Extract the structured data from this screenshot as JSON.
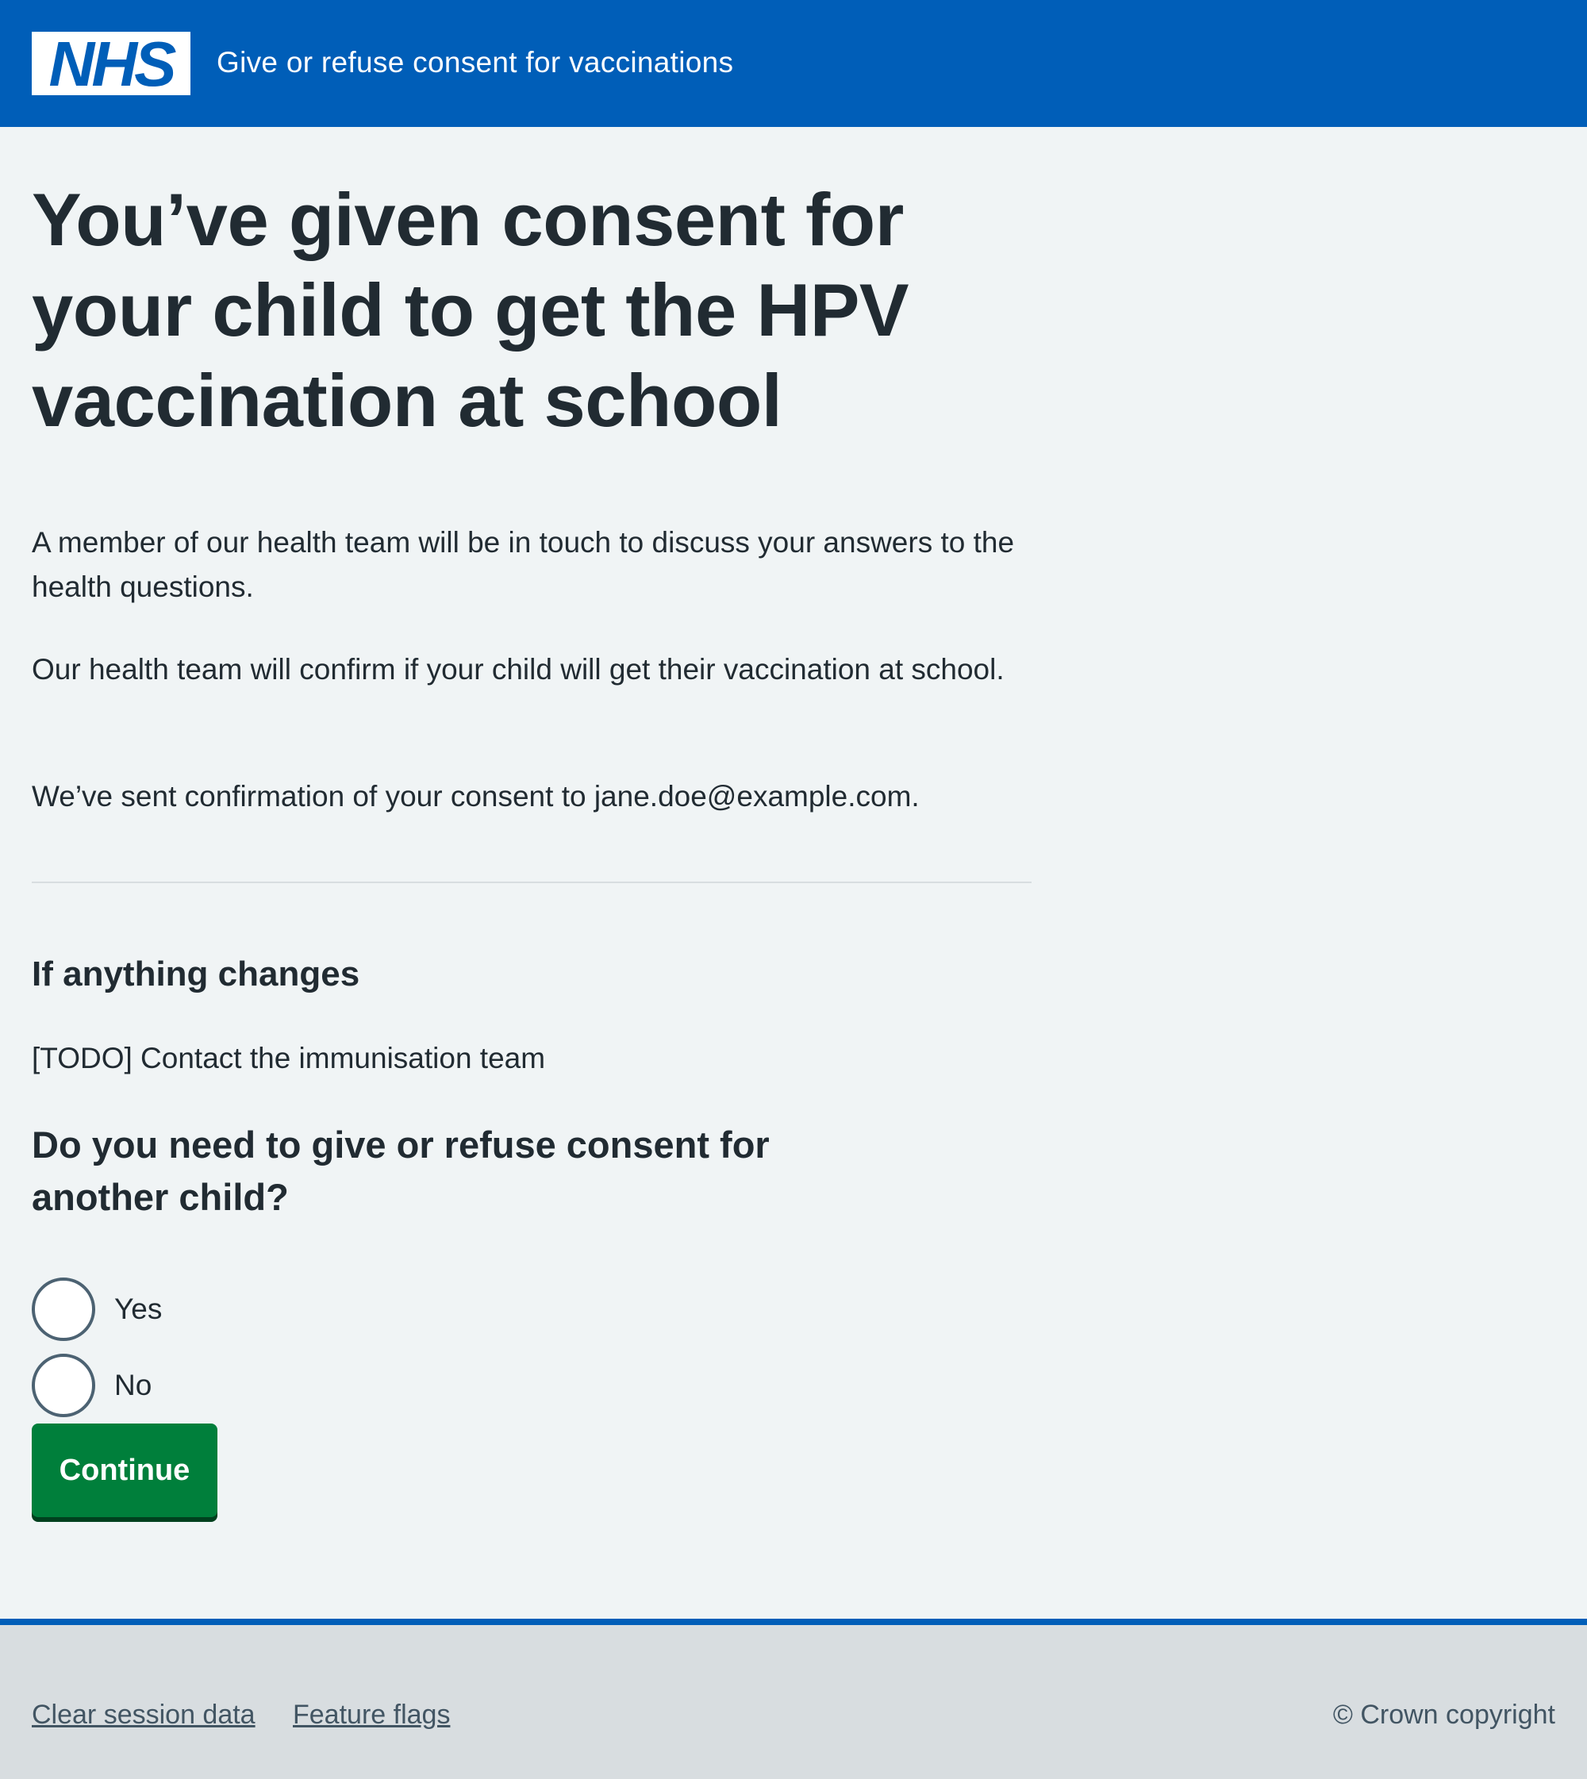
{
  "header": {
    "logo_text": "NHS",
    "service_name": "Give or refuse consent for vaccinations"
  },
  "main": {
    "title": "You’ve given consent for your child to get the HPV vaccination at school",
    "paragraphs": [
      "A member of our health team will be in touch to discuss your answers to the health questions.",
      "Our health team will confirm if your child will get their vaccination at school.",
      "We’ve sent confirmation of your consent to jane.doe@example.com."
    ],
    "changes_heading": "If anything changes",
    "changes_text": "[TODO] Contact the immunisation team",
    "question": "Do you need to give or refuse consent for another child?",
    "options": [
      "Yes",
      "No"
    ],
    "continue_label": "Continue"
  },
  "footer": {
    "links": [
      "Clear session data",
      "Feature flags"
    ],
    "copyright": "© Crown copyright"
  },
  "colors": {
    "nhs_blue": "#005eb8",
    "background": "#f0f4f5",
    "text": "#212b32",
    "button_green": "#007f3b",
    "footer_bg": "#d8dde0"
  }
}
